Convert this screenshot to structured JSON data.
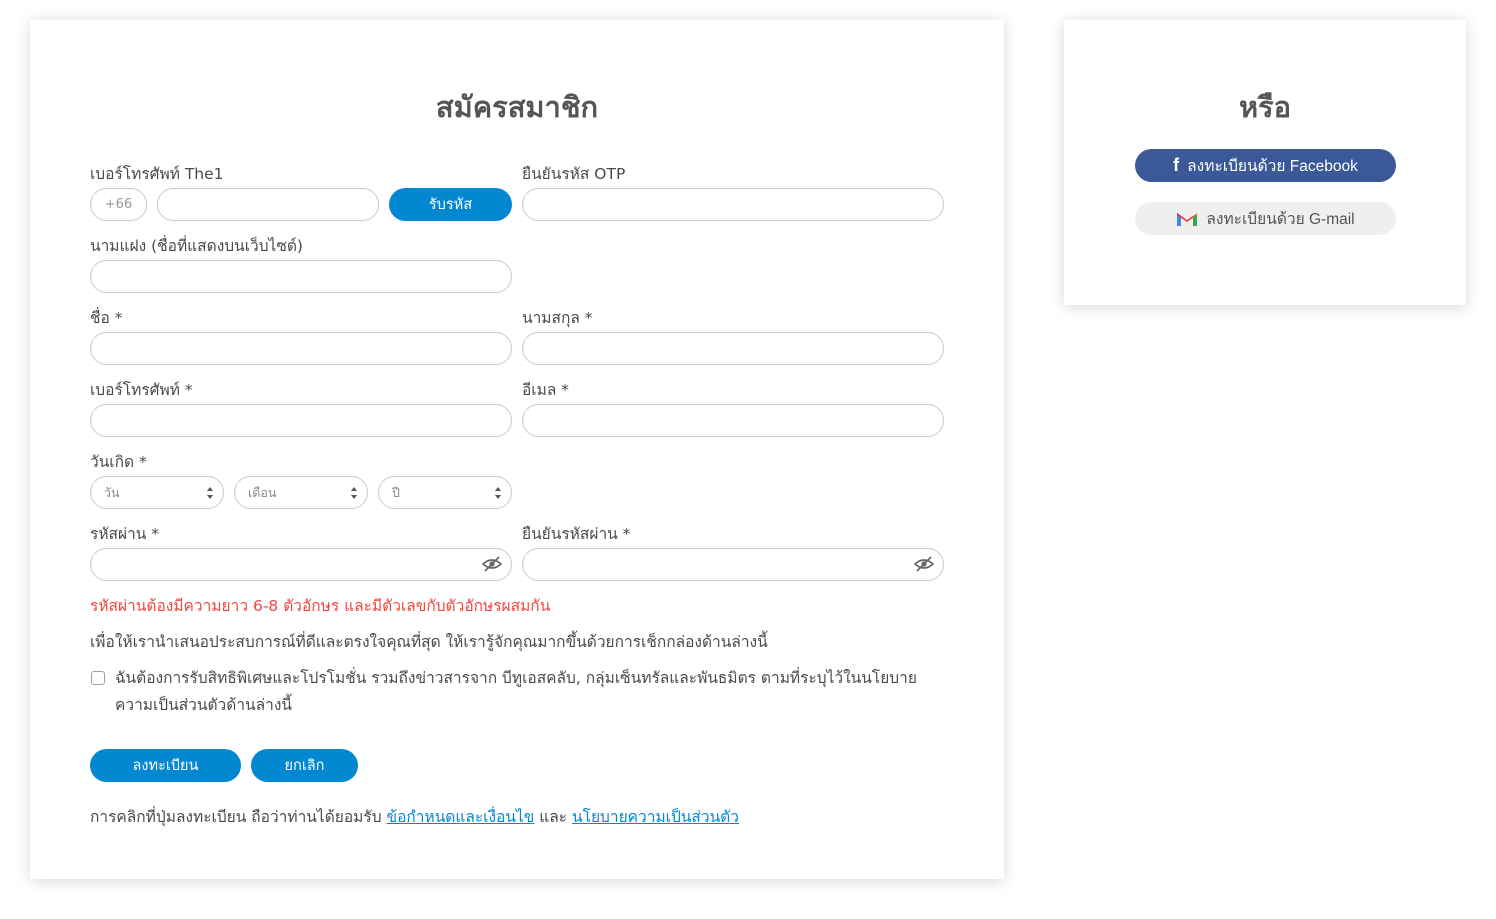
{
  "register": {
    "title": "สมัครสมาชิก",
    "the1_phone_label": "เบอร์โทรศัพท์ The1",
    "country_code": "+66",
    "get_otp_button": "รับรหัส",
    "otp_label": "ยืนยันรหัส OTP",
    "nickname_label": "นามแฝง (ชื่อที่แสดงบนเว็บไซต์)",
    "first_name_label": "ชื่อ *",
    "last_name_label": "นามสกุล *",
    "phone_label": "เบอร์โทรศัพท์ *",
    "email_label": "อีเมล *",
    "birthday_label": "วันเกิด *",
    "day_placeholder": "วัน",
    "month_placeholder": "เดือน",
    "year_placeholder": "ปี",
    "password_label": "รหัสผ่าน *",
    "confirm_password_label": "ยืนยันรหัสผ่าน *",
    "password_hint": "รหัสผ่านต้องมีความยาว 6-8 ตัวอักษร และมีตัวเลขกับตัวอักษรผสมกัน",
    "info_text": "เพื่อให้เรานำเสนอประสบการณ์ที่ดีและตรงใจคุณที่สุด ให้เรารู้จักคุณมากขึ้นด้วยการเช็กกล่องด้านล่างนี้",
    "consent_text": "ฉันต้องการรับสิทธิพิเศษและโปรโมชั่น รวมถึงข่าวสารจาก บีทูเอสคลับ, กลุ่มเซ็นทรัลและพันธมิตร ตามที่ระบุไว้ในนโยบายความเป็นส่วนตัวด้านล่างนี้",
    "submit_button": "ลงทะเบียน",
    "cancel_button": "ยกเลิก",
    "terms_prefix": "การคลิกที่ปุ่มลงทะเบียน ถือว่าท่านได้ยอมรับ",
    "terms_link": "ข้อกำหนดและเงื่อนไข",
    "terms_and": "และ",
    "privacy_link": "นโยบายความเป็นส่วนตัว"
  },
  "social": {
    "title": "หรือ",
    "facebook_button": "ลงทะเบียนด้วย Facebook",
    "gmail_button": "ลงทะเบียนด้วย G-mail",
    "facebook_color": "#3b5998",
    "accent_color": "#0288d1"
  }
}
